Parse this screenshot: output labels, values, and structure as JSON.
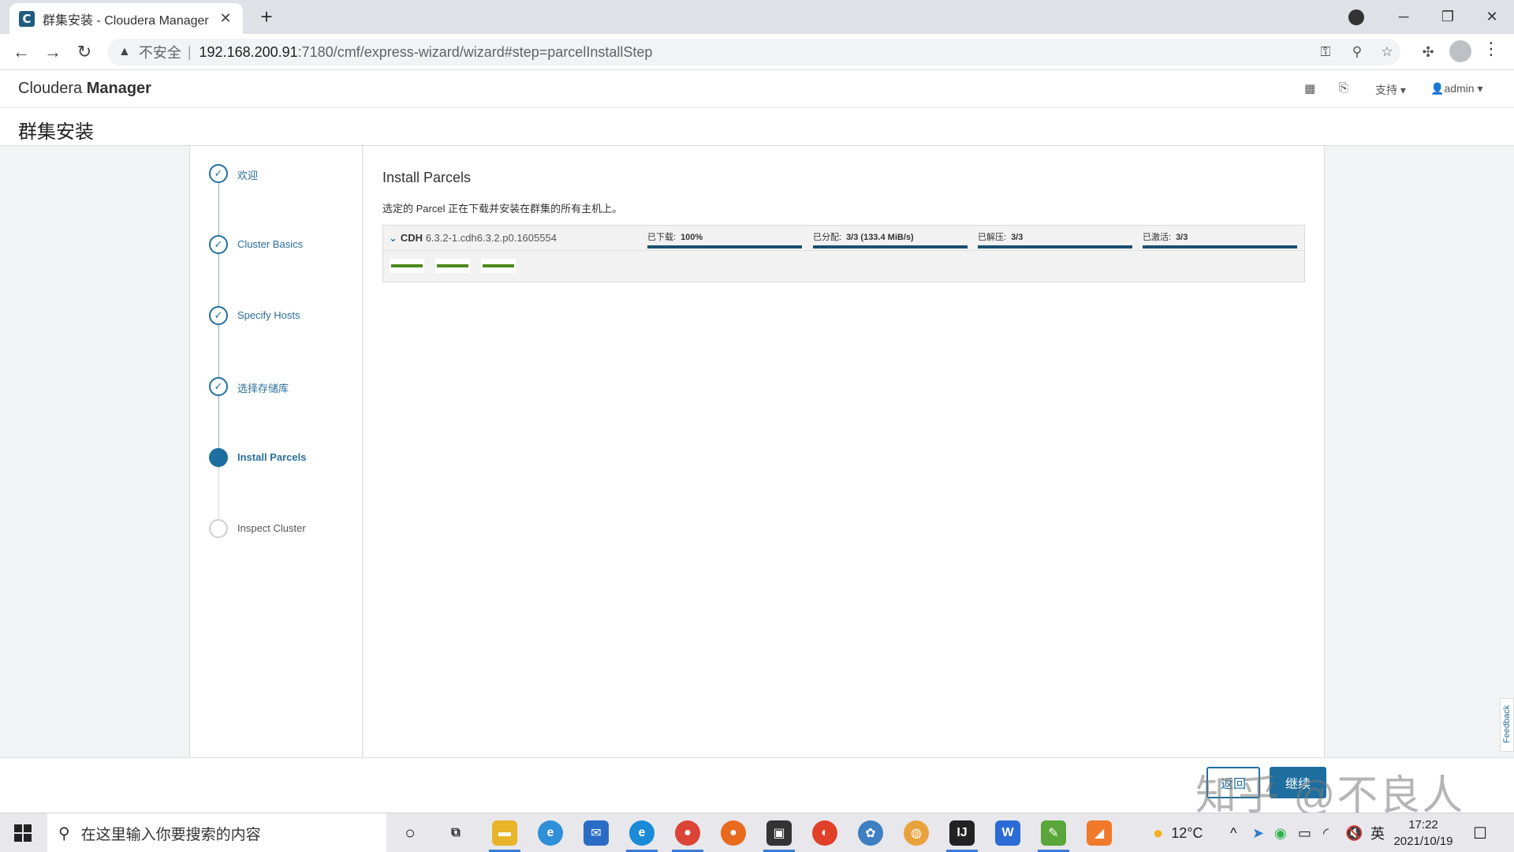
{
  "browser": {
    "tab_title": "群集安装 - Cloudera Manager",
    "tab_favicon": "C",
    "insecure_label": "不安全",
    "url_host": "192.168.200.91",
    "url_path": ":7180/cmf/express-wizard/wizard#step=parcelInstallStep"
  },
  "app": {
    "logo_light": "Cloudera ",
    "logo_bold": "Manager",
    "support_label": "支持 ▾",
    "user_label": "admin ▾",
    "page_title": "群集安装"
  },
  "steps": [
    {
      "label": "欢迎",
      "state": "done"
    },
    {
      "label": "Cluster Basics",
      "state": "done"
    },
    {
      "label": "Specify Hosts",
      "state": "done"
    },
    {
      "label": "选择存储库",
      "state": "done"
    },
    {
      "label": "Install Parcels",
      "state": "active"
    },
    {
      "label": "Inspect Cluster",
      "state": "pending"
    }
  ],
  "content": {
    "title": "Install Parcels",
    "description": "选定的 Parcel 正在下载并安装在群集的所有主机上。",
    "parcel": {
      "name": "CDH",
      "version": " 6.3.2-1.cdh6.3.2.p0.1605554",
      "stats": [
        {
          "label": "已下载:",
          "value": "100%",
          "progress": 1.0
        },
        {
          "label": "已分配:",
          "value": "3/3 (133.4 MiB/s)",
          "progress": 1.0
        },
        {
          "label": "已解压:",
          "value": "3/3",
          "progress": 1.0
        },
        {
          "label": "已激活:",
          "value": "3/3",
          "progress": 1.0
        }
      ],
      "hosts_count": 3
    }
  },
  "footer": {
    "back_label": "返回",
    "next_label": "继续",
    "watermark": "知乎 @不良人",
    "feedback_label": "Feedback"
  },
  "taskbar": {
    "search_placeholder": "在这里输入你要搜索的内容",
    "weather": "12°C",
    "ime": "英",
    "time": "17:22",
    "date": "2021/10/19"
  },
  "colors": {
    "accent": "#1e6fa0",
    "progress": "#1b4f72",
    "host_ok": "#4a8a1c"
  }
}
